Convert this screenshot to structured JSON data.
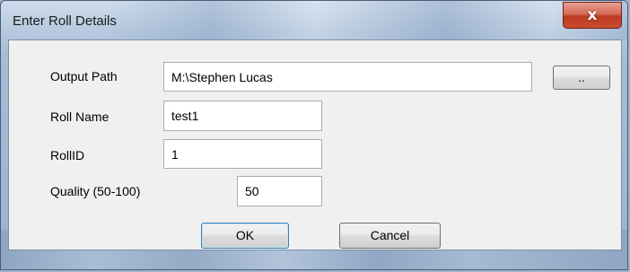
{
  "window": {
    "title": "Enter Roll Details",
    "close_symbol": "x"
  },
  "form": {
    "output_path": {
      "label": "Output Path",
      "value": "M:\\Stephen Lucas"
    },
    "browse_label": "..",
    "roll_name": {
      "label": "Roll Name",
      "value": "test1"
    },
    "roll_id": {
      "label": "RollID",
      "value": "1"
    },
    "quality": {
      "label": "Quality (50-100)",
      "value": "50"
    }
  },
  "buttons": {
    "ok": "OK",
    "cancel": "Cancel"
  }
}
